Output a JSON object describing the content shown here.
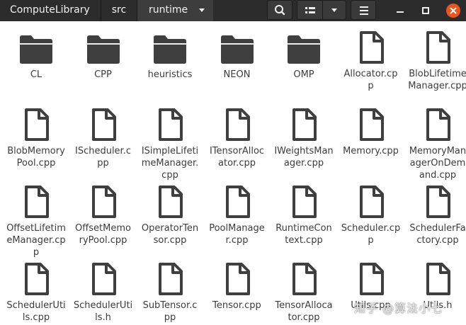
{
  "headerbar": {
    "breadcrumbs": [
      {
        "label": "ComputeLibrary"
      },
      {
        "label": "src"
      },
      {
        "label": "runtime"
      }
    ],
    "icons": [
      "search-icon",
      "view-list-icon",
      "chevron-down-icon",
      "hamburger-menu-icon",
      "minimize-icon",
      "maximize-icon",
      "close-icon"
    ],
    "accent_close": "#e95420"
  },
  "colors": {
    "folder": "#3f3f3f",
    "file": "#3f3f3f",
    "label": "#3c3c3c",
    "headerbar": "#2c2c2c"
  },
  "items": [
    {
      "label": "CL",
      "kind": "folder"
    },
    {
      "label": "CPP",
      "kind": "folder"
    },
    {
      "label": "heuristics",
      "kind": "folder"
    },
    {
      "label": "NEON",
      "kind": "folder"
    },
    {
      "label": "OMP",
      "kind": "folder"
    },
    {
      "label": "Allocator.cpp",
      "kind": "file"
    },
    {
      "label": "BlobLifetimeManager.cpp",
      "kind": "file"
    },
    {
      "label": "BlobMemoryPool.cpp",
      "kind": "file"
    },
    {
      "label": "IScheduler.cpp",
      "kind": "file"
    },
    {
      "label": "ISimpleLifetimeManager.cpp",
      "kind": "file"
    },
    {
      "label": "ITensorAllocator.cpp",
      "kind": "file"
    },
    {
      "label": "IWeightsManager.cpp",
      "kind": "file"
    },
    {
      "label": "Memory.cpp",
      "kind": "file"
    },
    {
      "label": "MemoryManagerOnDemand.cpp",
      "kind": "file"
    },
    {
      "label": "OffsetLifetimeManager.cpp",
      "kind": "file"
    },
    {
      "label": "OffsetMemoryPool.cpp",
      "kind": "file"
    },
    {
      "label": "OperatorTensor.cpp",
      "kind": "file"
    },
    {
      "label": "PoolManager.cpp",
      "kind": "file"
    },
    {
      "label": "RuntimeContext.cpp",
      "kind": "file"
    },
    {
      "label": "Scheduler.cpp",
      "kind": "file"
    },
    {
      "label": "SchedulerFactory.cpp",
      "kind": "file"
    },
    {
      "label": "SchedulerUtils.cpp",
      "kind": "file"
    },
    {
      "label": "SchedulerUtils.h",
      "kind": "file"
    },
    {
      "label": "SubTensor.cpp",
      "kind": "file"
    },
    {
      "label": "Tensor.cpp",
      "kind": "file"
    },
    {
      "label": "TensorAllocator.cpp",
      "kind": "file"
    },
    {
      "label": "Utils.cpp",
      "kind": "file"
    },
    {
      "label": "Utils.h",
      "kind": "file"
    }
  ],
  "watermark": "知乎 @算法小七"
}
